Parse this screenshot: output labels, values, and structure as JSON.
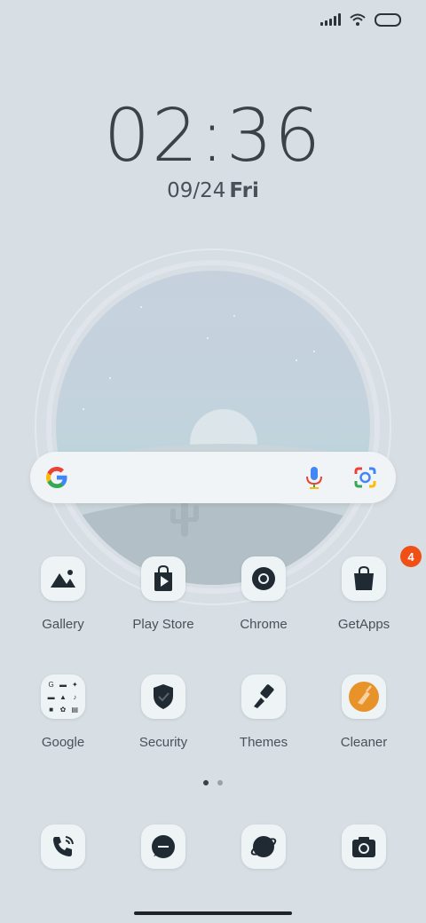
{
  "status_bar": {
    "signal_icon": "signal-icon",
    "wifi_icon": "wifi-icon",
    "battery_icon": "battery-icon"
  },
  "clock": {
    "time": "02:36",
    "date": "09/24",
    "day": "Fri"
  },
  "search_bar": {
    "google_icon": "google-g-icon",
    "mic_icon": "mic-icon",
    "lens_icon": "google-lens-icon"
  },
  "apps_row1": [
    {
      "label": "Gallery",
      "icon": "gallery-icon"
    },
    {
      "label": "Play Store",
      "icon": "play-store-icon"
    },
    {
      "label": "Chrome",
      "icon": "chrome-icon"
    },
    {
      "label": "GetApps",
      "icon": "getapps-icon",
      "badge": "4"
    }
  ],
  "apps_row2": [
    {
      "label": "Google",
      "icon": "google-folder-icon"
    },
    {
      "label": "Security",
      "icon": "security-icon"
    },
    {
      "label": "Themes",
      "icon": "themes-icon"
    },
    {
      "label": "Cleaner",
      "icon": "cleaner-icon"
    }
  ],
  "page_indicator": {
    "pages": 2,
    "current": 1
  },
  "dock": [
    {
      "icon": "phone-icon"
    },
    {
      "icon": "messages-icon"
    },
    {
      "icon": "browser-icon"
    },
    {
      "icon": "camera-icon"
    }
  ],
  "colors": {
    "background": "#d7dee4",
    "badge": "#f04f16",
    "cleaner_accent": "#e8922a"
  }
}
